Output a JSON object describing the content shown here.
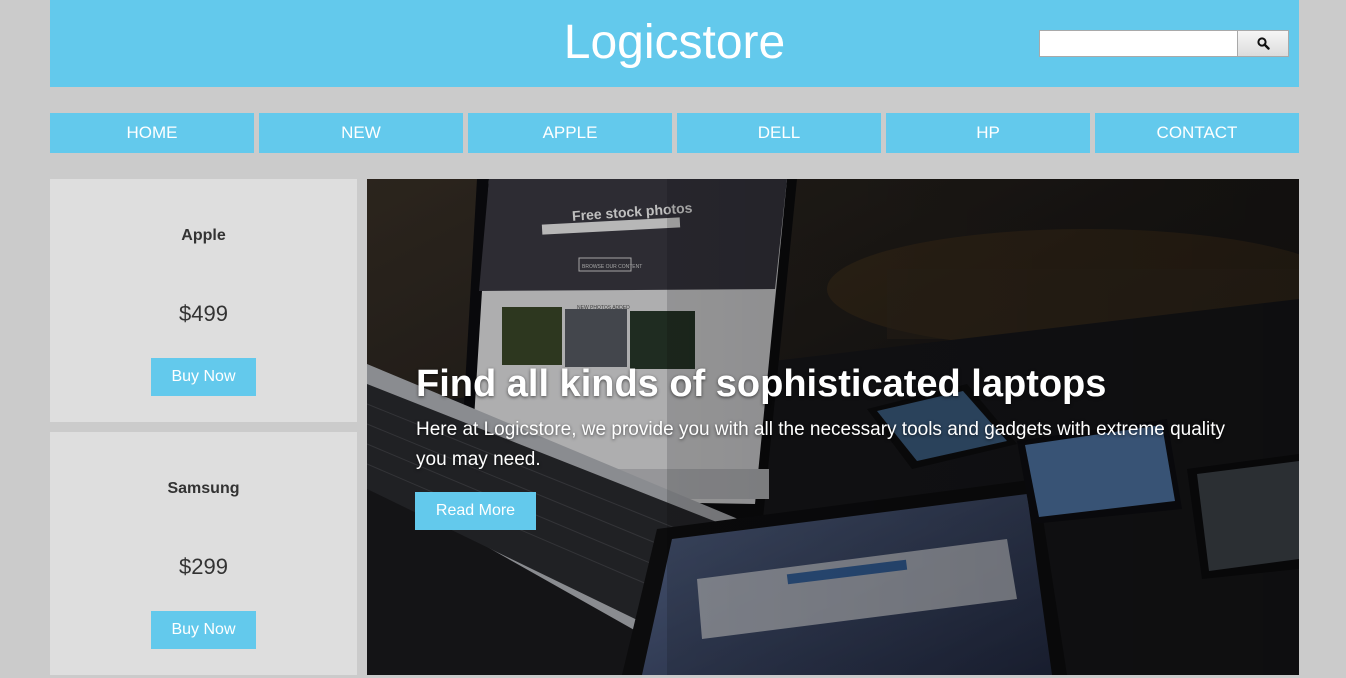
{
  "header": {
    "title": "Logicstore",
    "search": {
      "value": "",
      "placeholder": "",
      "icon": "search-icon"
    }
  },
  "nav": {
    "items": [
      {
        "label": "HOME"
      },
      {
        "label": "NEW"
      },
      {
        "label": "APPLE"
      },
      {
        "label": "DELL"
      },
      {
        "label": "HP"
      },
      {
        "label": "CONTACT"
      }
    ]
  },
  "products": [
    {
      "name": "Apple",
      "price": "$499",
      "button": "Buy Now"
    },
    {
      "name": "Samsung",
      "price": "$299",
      "button": "Buy Now"
    }
  ],
  "hero": {
    "title": "Find all kinds of sophisticated laptops",
    "text": "Here at Logicstore, we provide you with all the necessary tools and gadgets with extreme quality you may need.",
    "button": "Read More",
    "screen_heading": "Free stock photos",
    "screen_button": "BROWSE OUR CONTENT",
    "screen_section": "NEW PHOTOS ADDED"
  },
  "colors": {
    "accent": "#63c9ec",
    "page_background": "#cbcbcb",
    "card_background": "#dedede"
  }
}
